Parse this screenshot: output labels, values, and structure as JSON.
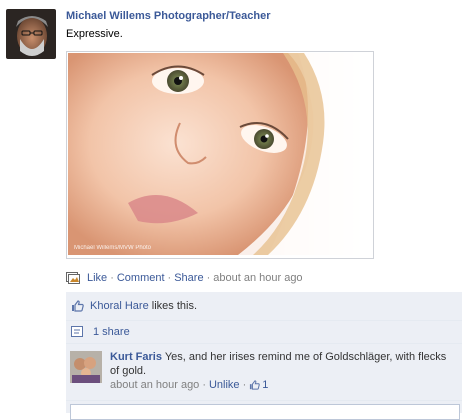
{
  "post": {
    "author": "Michael Willems Photographer/Teacher",
    "message": "Expressive.",
    "photo_watermark": "Michael Willems/MVW Photo",
    "actions": {
      "like": "Like",
      "comment": "Comment",
      "share": "Share",
      "timestamp": "about an hour ago",
      "separator": "·"
    }
  },
  "feedback": {
    "liker_name": "Khoral Hare",
    "likes_text": "likes this.",
    "shares_text": "1 share",
    "comment": {
      "author": "Kurt Faris",
      "text": "Yes, and her irises remind me of Goldschläger, with flecks of gold.",
      "timestamp": "about an hour ago",
      "unlike": "Unlike",
      "like_count": "1"
    }
  },
  "colors": {
    "link": "#3b5998",
    "feedback_bg": "#eceff5",
    "muted": "#808080"
  }
}
